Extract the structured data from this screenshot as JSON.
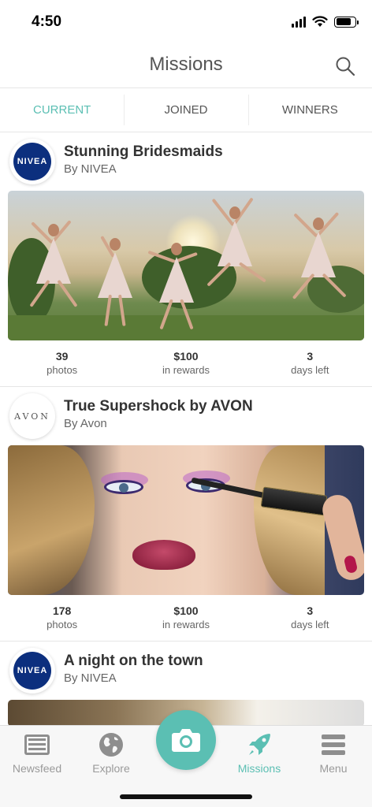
{
  "status_bar": {
    "time": "4:50",
    "icons": [
      "signal-icon",
      "wifi-icon",
      "battery-icon"
    ]
  },
  "header": {
    "title": "Missions",
    "search_icon": "search-icon"
  },
  "tabs": [
    {
      "label": "CURRENT",
      "active": true
    },
    {
      "label": "JOINED",
      "active": false
    },
    {
      "label": "WINNERS",
      "active": false
    }
  ],
  "missions": [
    {
      "title": "Stunning Bridesmaids",
      "sponsor": "By NIVEA",
      "logo_text": "NIVEA",
      "stats": [
        {
          "value": "39",
          "label": "photos"
        },
        {
          "value": "$100",
          "label": "in rewards"
        },
        {
          "value": "3",
          "label": "days left"
        }
      ]
    },
    {
      "title": "True Supershock by AVON",
      "sponsor": "By Avon",
      "logo_text": "AVON",
      "stats": [
        {
          "value": "178",
          "label": "photos"
        },
        {
          "value": "$100",
          "label": "in rewards"
        },
        {
          "value": "3",
          "label": "days left"
        }
      ]
    },
    {
      "title": "A night on the town",
      "sponsor": "By NIVEA",
      "logo_text": "NIVEA"
    }
  ],
  "tabbar": {
    "items": [
      {
        "label": "Newsfeed",
        "icon": "newsfeed-icon",
        "active": false
      },
      {
        "label": "Explore",
        "icon": "globe-icon",
        "active": false
      },
      {
        "label": "Missions",
        "icon": "rocket-icon",
        "active": true
      },
      {
        "label": "Menu",
        "icon": "menu-icon",
        "active": false
      }
    ],
    "camera_icon": "camera-icon"
  },
  "colors": {
    "accent": "#5bbfb3",
    "nivea_blue": "#0c2f7e",
    "text": "#333333",
    "muted": "#9a9a9a"
  }
}
